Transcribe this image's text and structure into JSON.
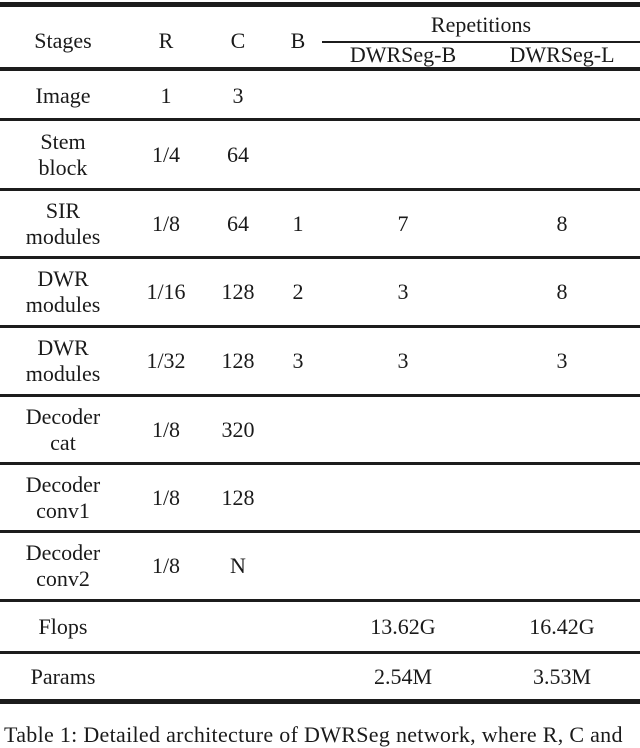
{
  "table": {
    "headers": {
      "stages": "Stages",
      "r": "R",
      "c": "C",
      "b": "B",
      "repetitions": "Repetitions",
      "dwrseg_b": "DWRSeg-B",
      "dwrseg_l": "DWRSeg-L"
    },
    "rows": [
      {
        "stage_line1": "Image",
        "stage_line2": "",
        "r": "1",
        "c": "3",
        "b": "",
        "dwrseg_b": "",
        "dwrseg_l": ""
      },
      {
        "stage_line1": "Stem",
        "stage_line2": "block",
        "r": "1/4",
        "c": "64",
        "b": "",
        "dwrseg_b": "",
        "dwrseg_l": ""
      },
      {
        "stage_line1": "SIR",
        "stage_line2": "modules",
        "r": "1/8",
        "c": "64",
        "b": "1",
        "dwrseg_b": "7",
        "dwrseg_l": "8"
      },
      {
        "stage_line1": "DWR",
        "stage_line2": "modules",
        "r": "1/16",
        "c": "128",
        "b": "2",
        "dwrseg_b": "3",
        "dwrseg_l": "8"
      },
      {
        "stage_line1": "DWR",
        "stage_line2": "modules",
        "r": "1/32",
        "c": "128",
        "b": "3",
        "dwrseg_b": "3",
        "dwrseg_l": "3"
      },
      {
        "stage_line1": "Decoder",
        "stage_line2": "cat",
        "r": "1/8",
        "c": "320",
        "b": "",
        "dwrseg_b": "",
        "dwrseg_l": ""
      },
      {
        "stage_line1": "Decoder",
        "stage_line2": "conv1",
        "r": "1/8",
        "c": "128",
        "b": "",
        "dwrseg_b": "",
        "dwrseg_l": ""
      },
      {
        "stage_line1": "Decoder",
        "stage_line2": "conv2",
        "r": "1/8",
        "c": "N",
        "b": "",
        "dwrseg_b": "",
        "dwrseg_l": ""
      },
      {
        "stage_line1": "Flops",
        "stage_line2": "",
        "r": "",
        "c": "",
        "b": "",
        "dwrseg_b": "13.62G",
        "dwrseg_l": "16.42G"
      },
      {
        "stage_line1": "Params",
        "stage_line2": "",
        "r": "",
        "c": "",
        "b": "",
        "dwrseg_b": "2.54M",
        "dwrseg_l": "3.53M"
      }
    ]
  },
  "caption": "Table 1:  Detailed architecture of DWRSeg network, where R, C and"
}
